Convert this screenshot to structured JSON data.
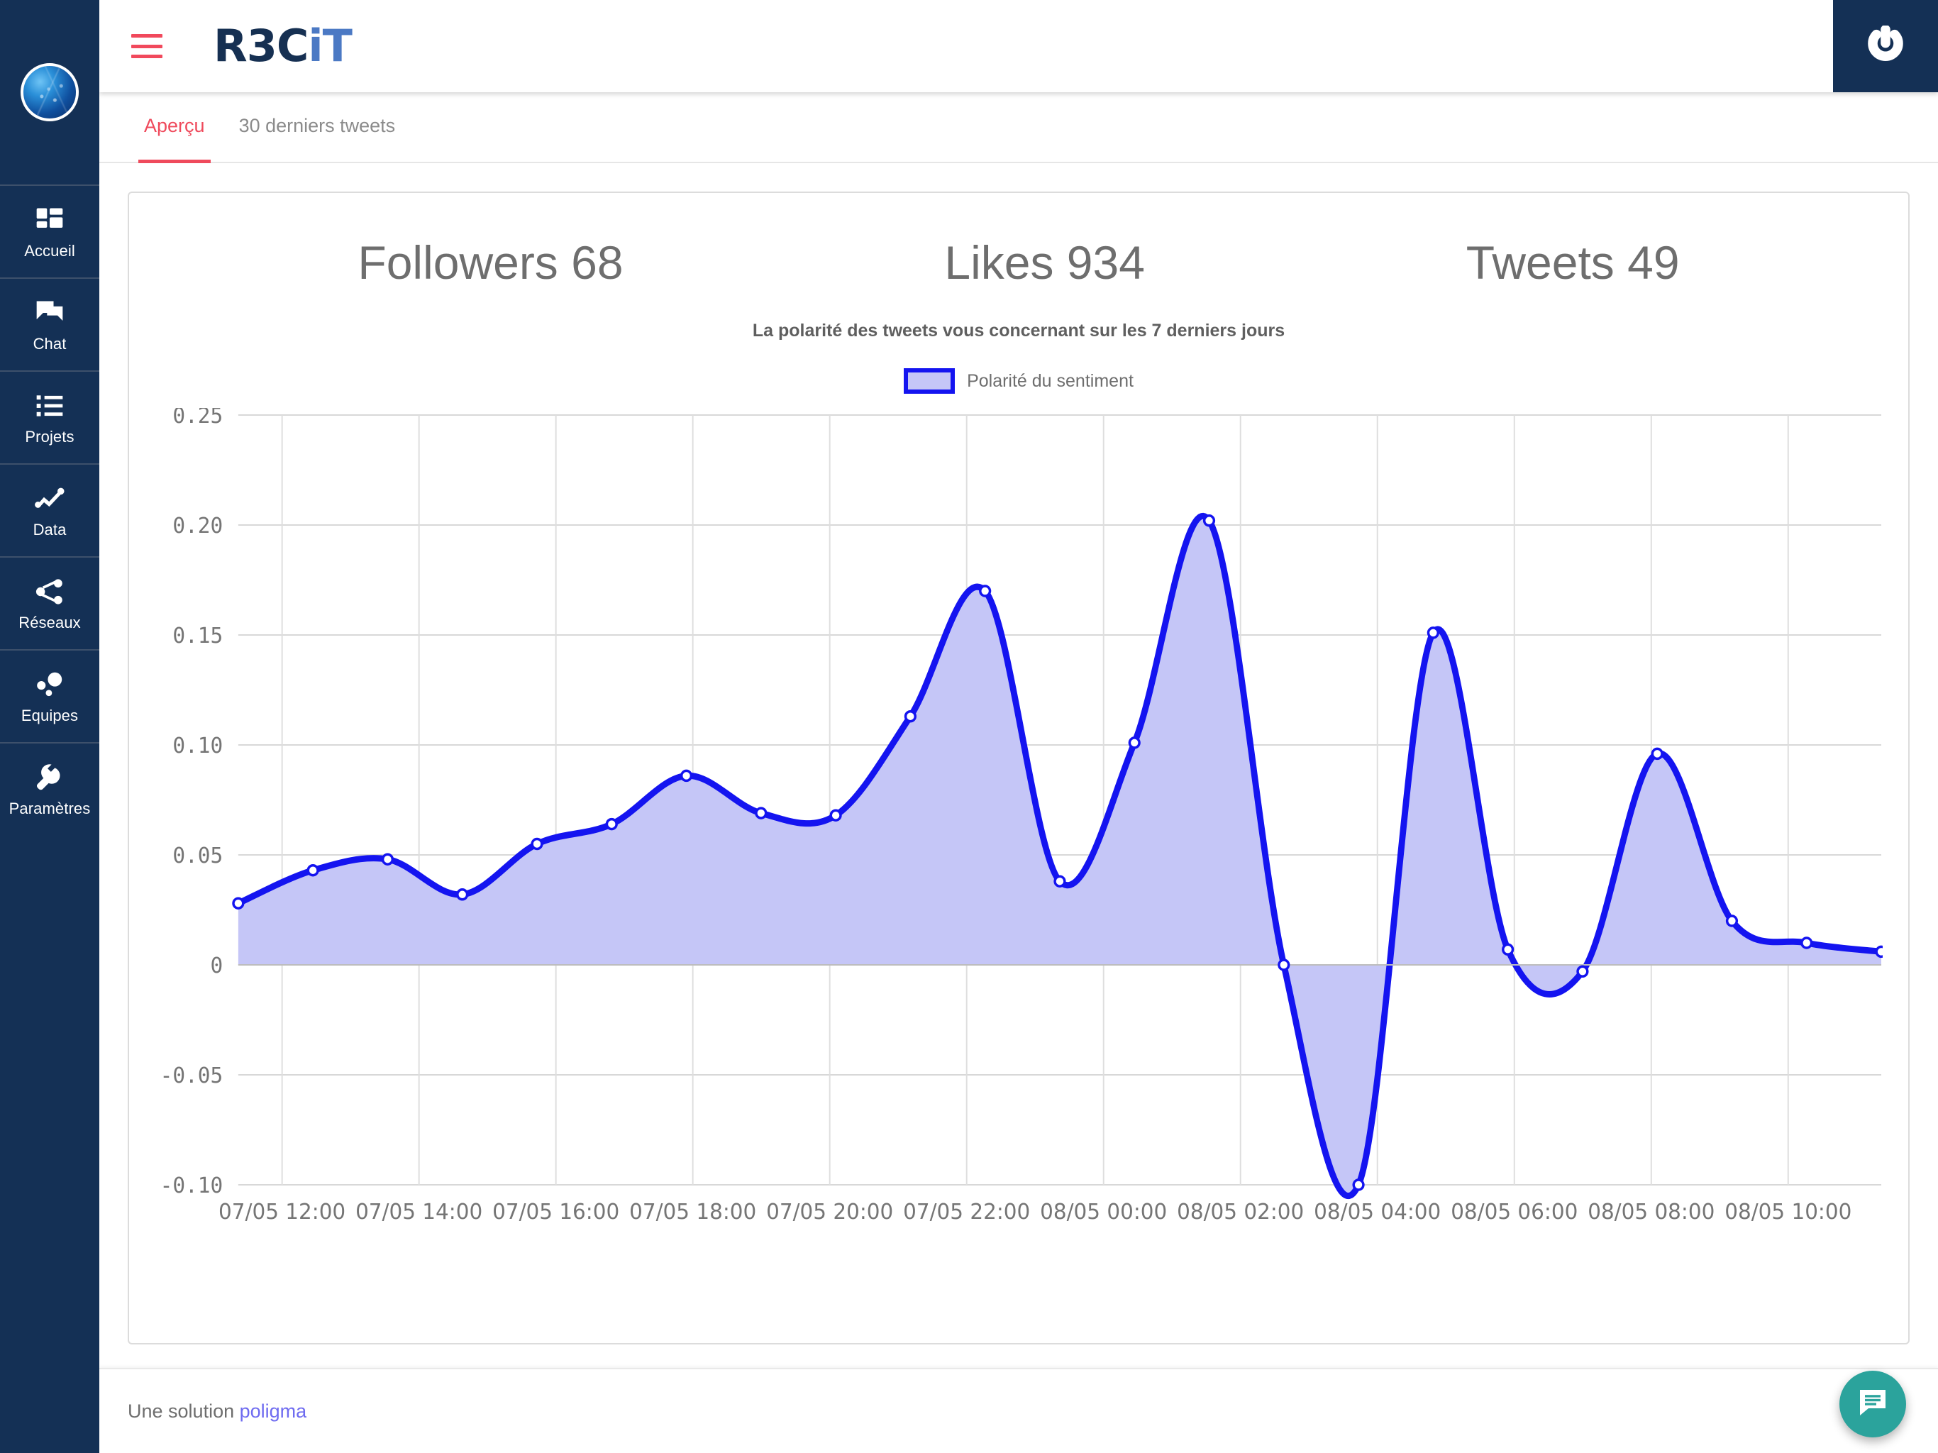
{
  "app": {
    "logo_primary": "R3C",
    "logo_secondary": "iT"
  },
  "sidebar": {
    "avatar_name": "user-avatar",
    "items": [
      {
        "label": "Accueil",
        "icon": "dashboard-icon"
      },
      {
        "label": "Chat",
        "icon": "chat-icon"
      },
      {
        "label": "Projets",
        "icon": "list-icon"
      },
      {
        "label": "Data",
        "icon": "trend-line-icon"
      },
      {
        "label": "Réseaux",
        "icon": "share-icon"
      },
      {
        "label": "Equipes",
        "icon": "bubbles-icon"
      },
      {
        "label": "Paramètres",
        "icon": "wrench-icon"
      }
    ]
  },
  "topbar": {
    "menu_icon": "hamburger-icon",
    "power_icon": "power-icon"
  },
  "tabs": [
    {
      "label": "Aperçu",
      "active": true
    },
    {
      "label": "30 derniers tweets",
      "active": false
    }
  ],
  "stats": [
    {
      "label": "Followers",
      "value": "68",
      "text": "Followers 68"
    },
    {
      "label": "Likes",
      "value": "934",
      "text": "Likes 934"
    },
    {
      "label": "Tweets",
      "value": "49",
      "text": "Tweets 49"
    }
  ],
  "footer": {
    "prefix": "Une solution",
    "link": "poligma"
  },
  "fab": {
    "icon": "chat-bubble-icon"
  },
  "colors": {
    "sidebar_bg": "#143055",
    "accent_red": "#ef4a5c",
    "line_blue": "#1414f0",
    "area_fill": "#c5c6f7",
    "logo_light": "#4b79c4",
    "fab_teal": "#2ba39c",
    "link_purple": "#6e6bf0"
  },
  "chart_data": {
    "type": "area",
    "title": "La polarité des tweets vous concernant sur les 7 derniers jours",
    "xlabel": "",
    "ylabel": "",
    "grid": true,
    "legend_position": "top-center",
    "series": [
      {
        "name": "Polarité du sentiment",
        "color": "#1414f0",
        "fill": "#c5c6f7",
        "values": [
          0.028,
          0.043,
          0.048,
          0.032,
          0.055,
          0.064,
          0.086,
          0.069,
          0.068,
          0.113,
          0.17,
          0.038,
          0.101,
          0.202,
          0.0,
          -0.1,
          0.151,
          0.007,
          -0.003,
          0.096,
          0.02,
          0.01,
          0.006
        ]
      }
    ],
    "x": [
      "07/05 11:30",
      "07/05 12:30",
      "07/05 13:30",
      "07/05 14:30",
      "07/05 15:30",
      "07/05 16:30",
      "07/05 17:30",
      "07/05 18:30",
      "07/05 19:30",
      "07/05 20:30",
      "07/05 21:30",
      "07/05 22:45",
      "07/05 23:45",
      "08/05 00:45",
      "08/05 02:45",
      "08/05 04:00",
      "08/05 05:00",
      "08/05 06:00",
      "08/05 06:30",
      "08/05 08:00",
      "08/05 09:00",
      "08/05 10:00",
      "08/05 11:00"
    ],
    "xticks": [
      "07/05 12:00",
      "07/05 14:00",
      "07/05 16:00",
      "07/05 18:00",
      "07/05 20:00",
      "07/05 22:00",
      "08/05 00:00",
      "08/05 02:00",
      "08/05 04:00",
      "08/05 06:00",
      "08/05 08:00",
      "08/05 10:00"
    ],
    "yticks": [
      "0.25",
      "0.20",
      "0.15",
      "0.10",
      "0.05",
      "0",
      "-0.05",
      "-0.10"
    ],
    "ytick_values": [
      0.25,
      0.2,
      0.15,
      0.1,
      0.05,
      0,
      -0.05,
      -0.1
    ],
    "ylim": [
      -0.1,
      0.25
    ],
    "legend": [
      "Polarité du sentiment"
    ]
  }
}
